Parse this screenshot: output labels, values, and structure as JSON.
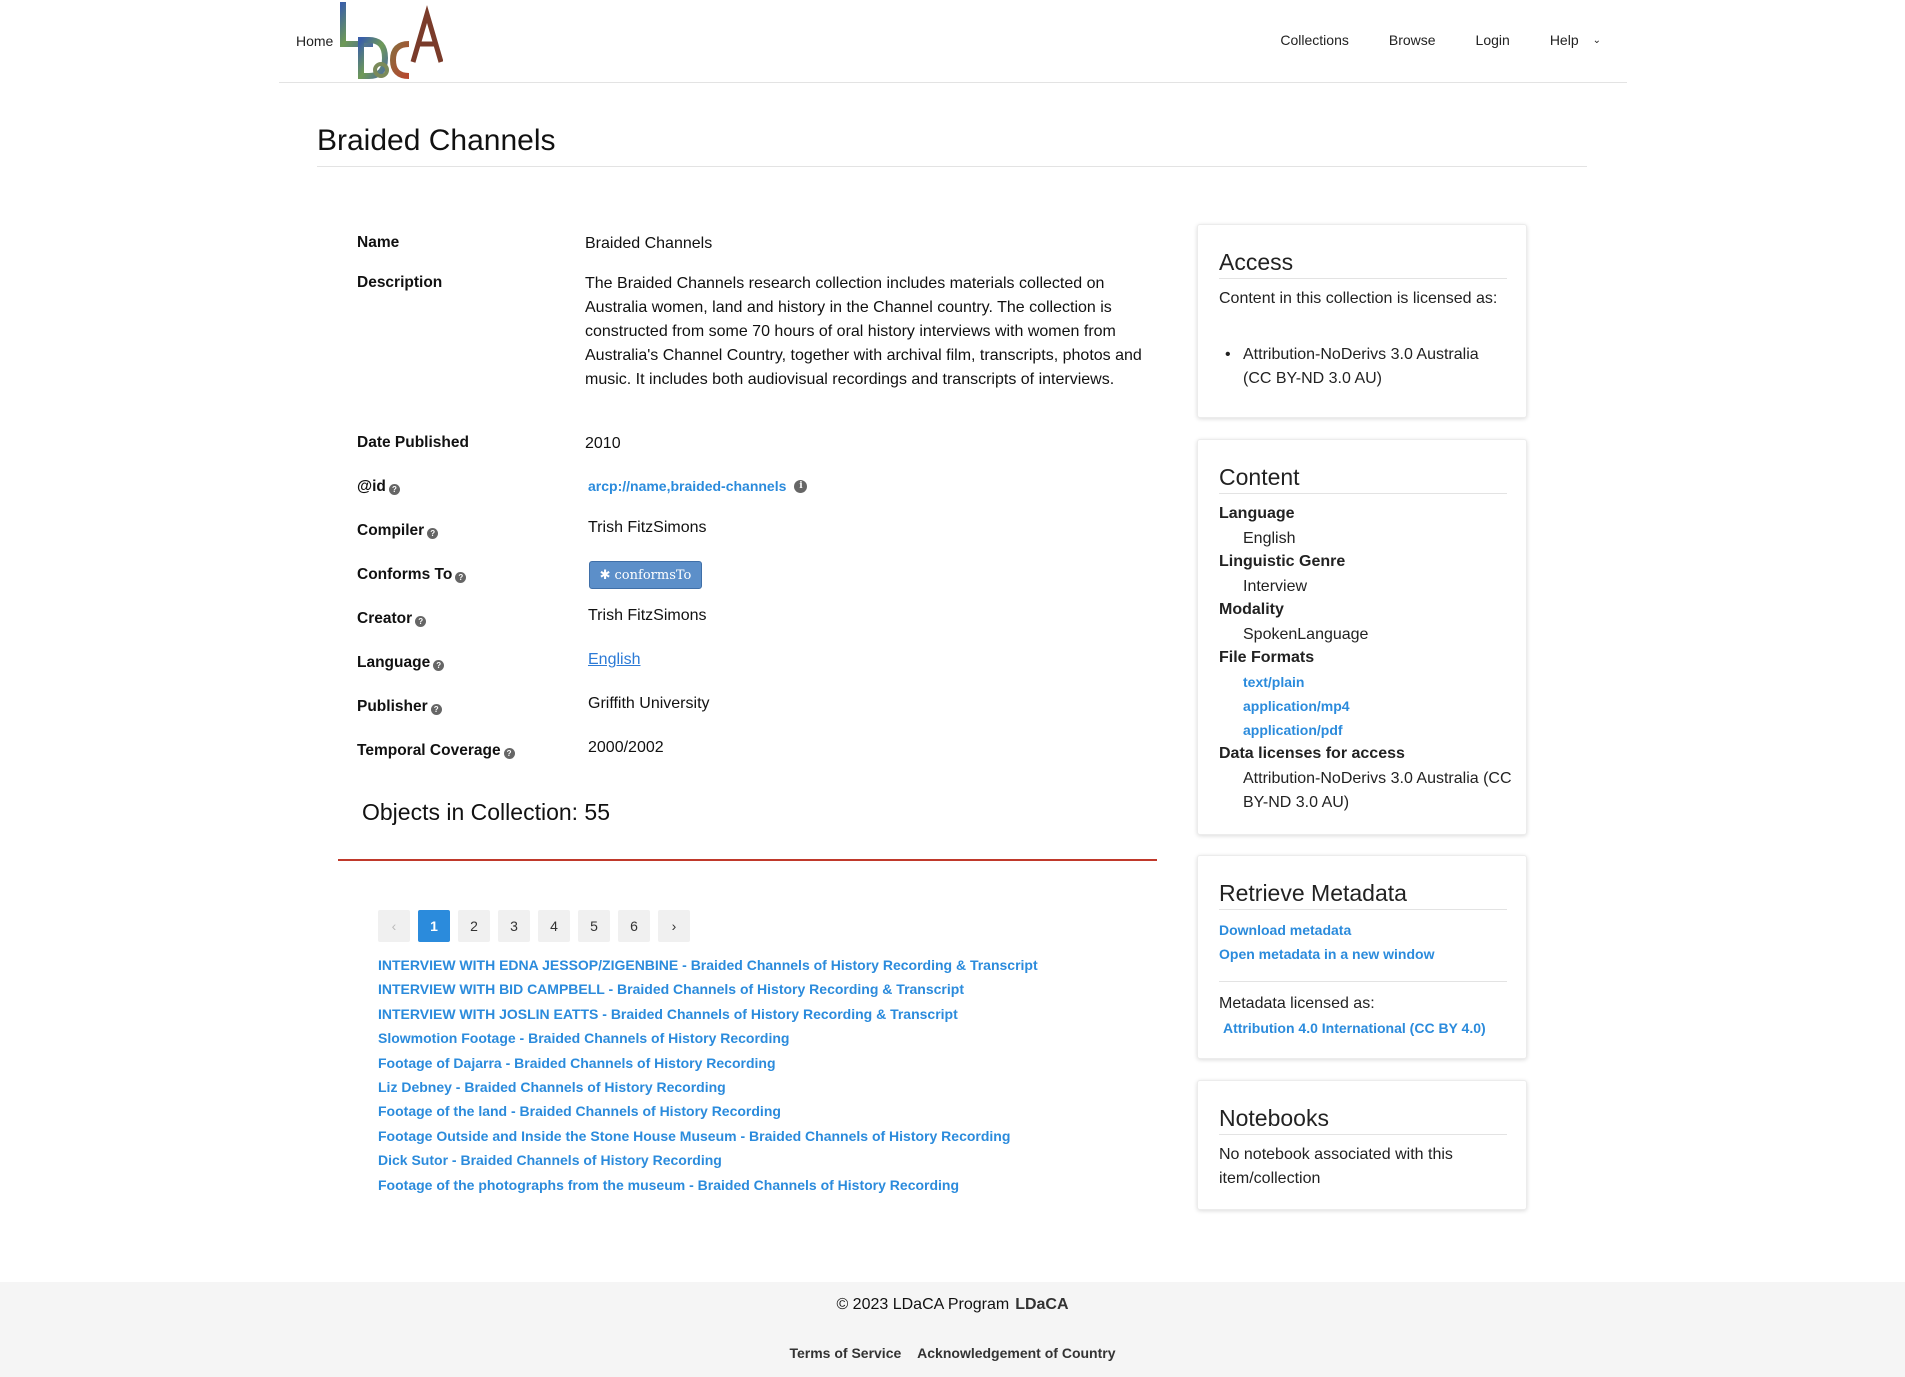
{
  "nav": {
    "home": "Home",
    "logo_text": "LDaCA",
    "links": [
      "Collections",
      "Browse",
      "Login",
      "Help"
    ]
  },
  "page": {
    "title": "Braided Channels"
  },
  "fields": {
    "name_label": "Name",
    "name_value": "Braided Channels",
    "description_label": "Description",
    "description_value": "The Braided Channels research collection includes materials collected on Australia women, land and history in the Channel country. The collection is constructed from some 70 hours of oral history interviews with women from Australia's Channel Country, together with archival film, transcripts, photos and music. It includes both audiovisual recordings and transcripts of interviews.",
    "date_label": "Date Published",
    "date_value": "2010",
    "id_label": "@id",
    "id_value": "arcp://name,braided-channels",
    "compiler_label": "Compiler",
    "compiler_value": "Trish FitzSimons",
    "conforms_label": "Conforms To",
    "conforms_value": "conformsTo",
    "creator_label": "Creator",
    "creator_value": "Trish FitzSimons",
    "language_label": "Language",
    "language_value": "English",
    "publisher_label": "Publisher",
    "publisher_value": "Griffith University",
    "temporal_label": "Temporal Coverage",
    "temporal_value": "2000/2002"
  },
  "objects": {
    "heading": "Objects in Collection: 55",
    "pages": [
      "1",
      "2",
      "3",
      "4",
      "5",
      "6"
    ],
    "current_page": "1",
    "prev_icon": "‹",
    "next_icon": "›",
    "items": [
      "INTERVIEW WITH EDNA JESSOP/ZIGENBINE - Braided Channels of History Recording & Transcript",
      "INTERVIEW WITH BID CAMPBELL - Braided Channels of History Recording & Transcript",
      "INTERVIEW WITH JOSLIN EATTS - Braided Channels of History Recording & Transcript",
      "Slowmotion Footage - Braided Channels of History Recording",
      "Footage of Dajarra - Braided Channels of History Recording",
      "Liz Debney - Braided Channels of History Recording",
      "Footage of the land - Braided Channels of History Recording",
      "Footage Outside and Inside the Stone House Museum - Braided Channels of History Recording",
      "Dick Sutor - Braided Channels of History Recording",
      "Footage of the photographs from the museum - Braided Channels of History Recording"
    ]
  },
  "access": {
    "title": "Access",
    "text": "Content in this collection is licensed as:",
    "license": "Attribution-NoDerivs 3.0 Australia (CC BY-ND 3.0 AU)"
  },
  "content": {
    "title": "Content",
    "language_label": "Language",
    "language_value": "English",
    "genre_label": "Linguistic Genre",
    "genre_value": "Interview",
    "modality_label": "Modality",
    "modality_value": "SpokenLanguage",
    "formats_label": "File Formats",
    "formats": [
      "text/plain",
      "application/mp4",
      "application/pdf"
    ],
    "licenses_label": "Data licenses for access",
    "licenses_value": "Attribution-NoDerivs 3.0 Australia (CC BY-ND 3.0 AU)"
  },
  "retrieve": {
    "title": "Retrieve Metadata",
    "download": "Download metadata",
    "open": "Open metadata in a new window",
    "licensed_as": "Metadata licensed as:",
    "license": "Attribution 4.0 International (CC BY 4.0)"
  },
  "notebooks": {
    "title": "Notebooks",
    "text": "No notebook associated with this item/collection"
  },
  "footer": {
    "copyright": "© 2023 LDaCA Program",
    "brand": "LDaCA",
    "terms": "Terms of Service",
    "acknowledgement": "Acknowledgement of Country"
  }
}
